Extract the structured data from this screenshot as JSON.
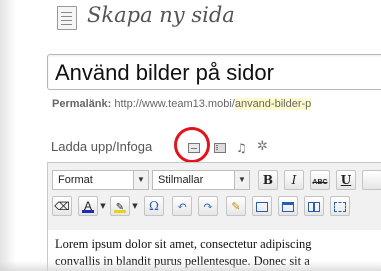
{
  "header": {
    "title": "Skapa ny sida"
  },
  "post": {
    "title": "Använd bilder på sidor"
  },
  "permalink": {
    "label": "Permalänk:",
    "base": "http://www.team13.mobi/",
    "slug": "anvand-bilder-p"
  },
  "media": {
    "label": "Ladda upp/Infoga",
    "buttons": [
      {
        "name": "add-image",
        "icon": "image-icon"
      },
      {
        "name": "add-video",
        "icon": "video-icon"
      },
      {
        "name": "add-audio",
        "icon": "music-note-icon",
        "glyph": "♫"
      },
      {
        "name": "add-media",
        "icon": "gear-icon",
        "glyph": "✲"
      }
    ],
    "highlight_color": "#e0141b"
  },
  "toolbar": {
    "format_select": "Format",
    "style_select": "Stilmallar",
    "bold": "B",
    "italic": "I",
    "strike": "ABC",
    "underline": "U",
    "text_color_glyph": "A",
    "special_char": "Ω",
    "undo": "↶",
    "redo": "↷",
    "text_color": "#1b2fb5",
    "highlight_color": "#e6d21e"
  },
  "content": {
    "line1": "Lorem ipsum dolor sit amet, consectetur adipiscing",
    "line2": "convallis in blandit purus pellentesque. Donec sit a"
  }
}
